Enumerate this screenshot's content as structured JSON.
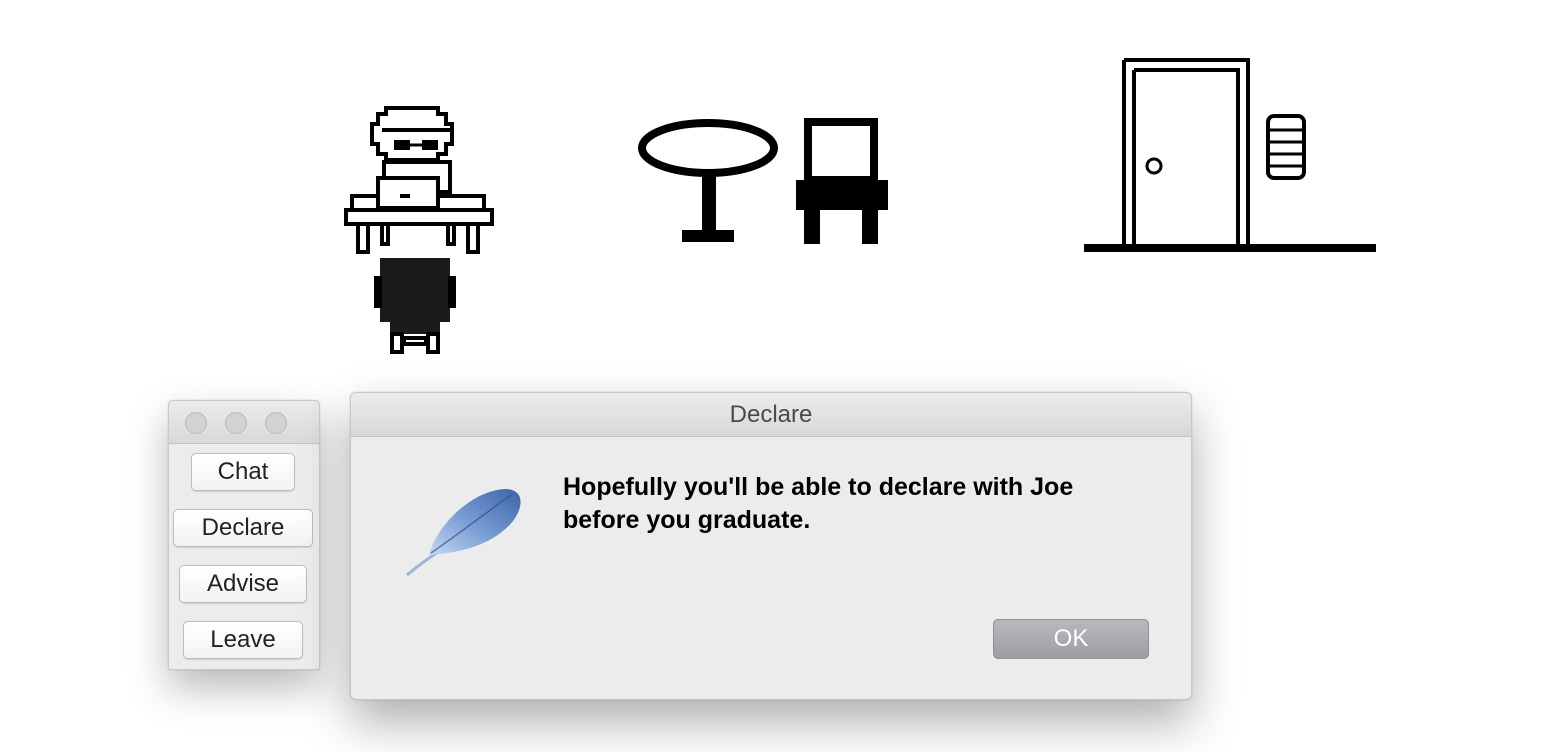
{
  "menu_window": {
    "buttons": [
      {
        "label": "Chat"
      },
      {
        "label": "Declare"
      },
      {
        "label": "Advise"
      },
      {
        "label": "Leave"
      }
    ]
  },
  "dialog": {
    "title": "Declare",
    "icon": "feather-icon",
    "message_line1": "Hopefully you'll be able to declare with Joe",
    "message_line2": "before you graduate.",
    "ok_label": "OK"
  },
  "scene": {
    "sprites": [
      "advisor-at-desk-sprite",
      "round-table-sprite",
      "chair-sprite",
      "door-sprite",
      "thermostat-sprite"
    ]
  },
  "colors": {
    "sprite_ink": "#000000",
    "window_bg": "#ececec",
    "ok_button": "#a8a8ad"
  }
}
